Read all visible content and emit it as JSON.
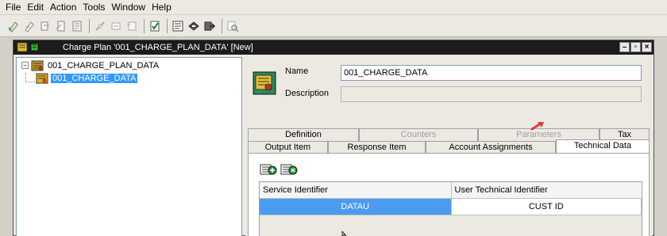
{
  "menu": [
    "File",
    "Edit",
    "Action",
    "Tools",
    "Window",
    "Help"
  ],
  "toolbar_icons": [
    "new-icon",
    "edit-icon",
    "copy-icon",
    "rename-icon",
    "properties-icon",
    "link-icon",
    "unlink-icon",
    "check-icon",
    "report-icon",
    "import-icon",
    "export-icon",
    "search-icon"
  ],
  "window": {
    "title": "Charge Plan '001_CHARGE_PLAN_DATA' [New]"
  },
  "tree": {
    "root_label": "001_CHARGE_PLAN_DATA",
    "root_toggle": "−",
    "child_label": "001_CHARGE_DATA"
  },
  "form": {
    "name_label": "Name",
    "name_value": "001_CHARGE_DATA",
    "description_label": "Description",
    "description_value": ""
  },
  "tabs_row1": [
    "Definition",
    "Counters",
    "Parameters",
    "Tax"
  ],
  "tabs_row2": [
    "Output Item",
    "Response Item",
    "Account Assignments",
    "Technical Data"
  ],
  "grid": {
    "headers": [
      "Service Identifier",
      "User Technical Identifier"
    ],
    "rows": [
      [
        "DATAU",
        "CUST ID"
      ]
    ]
  },
  "colors": {
    "selection": "#3399ff",
    "titlebar": "#1c1c1c",
    "annotation_arrow": "#e53935"
  }
}
